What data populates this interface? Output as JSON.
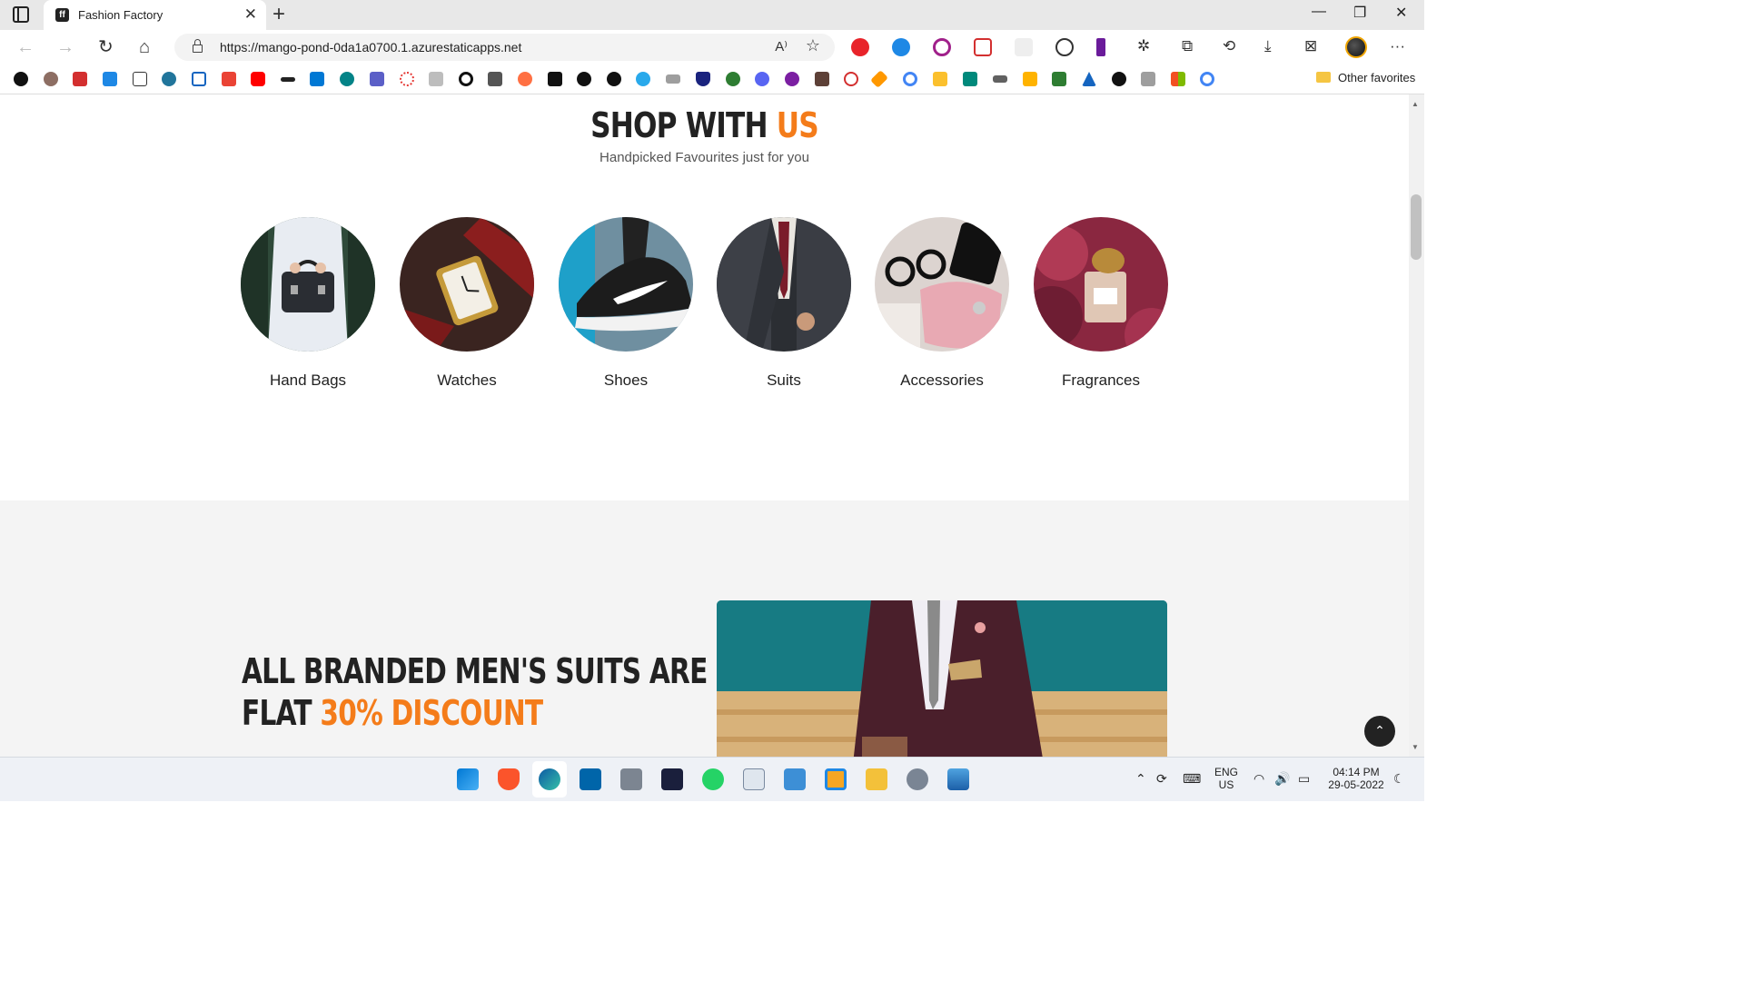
{
  "browser": {
    "tab_title": "Fashion Factory",
    "url": "https://mango-pond-0da1a0700.1.azurestaticapps.net",
    "other_favorites": "Other favorites"
  },
  "section": {
    "title_main": "SHOP WITH",
    "title_accent": "US",
    "subtitle": "Handpicked Favourites just for you"
  },
  "categories": [
    {
      "label": "Hand Bags",
      "image": "woman-holding-black-handbag"
    },
    {
      "label": "Watches",
      "image": "gold-watch-red-strap"
    },
    {
      "label": "Shoes",
      "image": "black-sneaker"
    },
    {
      "label": "Suits",
      "image": "man-in-suit"
    },
    {
      "label": "Accessories",
      "image": "pink-bag-and-glasses"
    },
    {
      "label": "Fragrances",
      "image": "perfume-bottle-roses"
    }
  ],
  "promo": {
    "line1": "ALL BRANDED MEN'S SUITS ARE",
    "line2_prefix": "FLAT",
    "line2_accent": "30% DISCOUNT",
    "image": "man-in-burgundy-suit"
  },
  "taskbar": {
    "lang": "ENG",
    "region": "US",
    "time": "04:14 PM",
    "date": "29-05-2022"
  },
  "colors": {
    "accent": "#f47c1a",
    "heading": "#222222",
    "section_gray": "#f4f4f4"
  }
}
